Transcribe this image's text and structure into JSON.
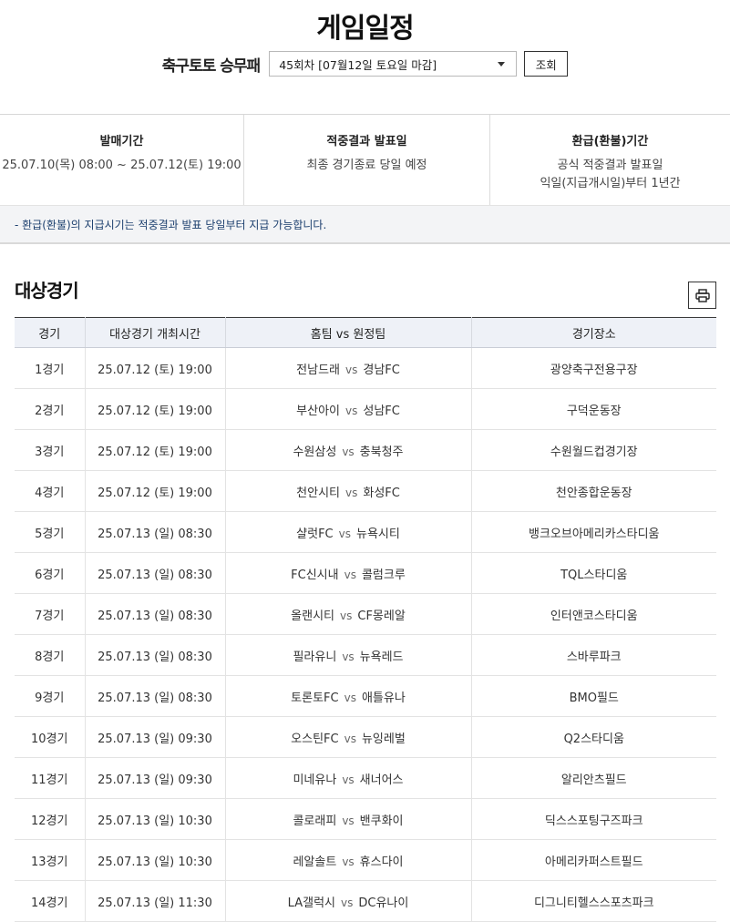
{
  "page": {
    "title": "게임일정"
  },
  "selector": {
    "game_name": "축구토토 승무패",
    "round_value": "45회차 [07월12일 토요일 마감]",
    "query_label": "조회"
  },
  "info": {
    "sale_period": {
      "label": "발매기간",
      "value": "25.07.10(목) 08:00 ~ 25.07.12(토) 19:00"
    },
    "result_date": {
      "label": "적중결과 발표일",
      "value": "최종 경기종료 당일 예정"
    },
    "refund_period": {
      "label": "환급(환불)기간",
      "line1": "공식 적중결과 발표일",
      "line2": "익일(지급개시일)부터 1년간"
    }
  },
  "notice": "- 환급(환불)의 지급시기는 적중결과 발표 당일부터 지급 가능합니다.",
  "section": {
    "title": "대상경기",
    "print_icon": "printer-icon"
  },
  "table": {
    "headers": [
      "경기",
      "대상경기 개최시간",
      "홈팀 vs 원정팀",
      "경기장소"
    ],
    "vs_label": "vs",
    "rows": [
      {
        "no": "1경기",
        "time": "25.07.12 (토) 19:00",
        "home": "전남드래",
        "away": "경남FC",
        "venue": "광양축구전용구장"
      },
      {
        "no": "2경기",
        "time": "25.07.12 (토) 19:00",
        "home": "부산아이",
        "away": "성남FC",
        "venue": "구덕운동장"
      },
      {
        "no": "3경기",
        "time": "25.07.12 (토) 19:00",
        "home": "수원삼성",
        "away": "충북청주",
        "venue": "수원월드컵경기장"
      },
      {
        "no": "4경기",
        "time": "25.07.12 (토) 19:00",
        "home": "천안시티",
        "away": "화성FC",
        "venue": "천안종합운동장"
      },
      {
        "no": "5경기",
        "time": "25.07.13 (일) 08:30",
        "home": "샬럿FC",
        "away": "뉴욕시티",
        "venue": "뱅크오브아메리카스타디움"
      },
      {
        "no": "6경기",
        "time": "25.07.13 (일) 08:30",
        "home": "FC신시내",
        "away": "콜럼크루",
        "venue": "TQL스타디움"
      },
      {
        "no": "7경기",
        "time": "25.07.13 (일) 08:30",
        "home": "올랜시티",
        "away": "CF몽레알",
        "venue": "인터앤코스타디움"
      },
      {
        "no": "8경기",
        "time": "25.07.13 (일) 08:30",
        "home": "필라유니",
        "away": "뉴욕레드",
        "venue": "스바루파크"
      },
      {
        "no": "9경기",
        "time": "25.07.13 (일) 08:30",
        "home": "토론토FC",
        "away": "애틀유나",
        "venue": "BMO필드"
      },
      {
        "no": "10경기",
        "time": "25.07.13 (일) 09:30",
        "home": "오스틴FC",
        "away": "뉴잉레벌",
        "venue": "Q2스타디움"
      },
      {
        "no": "11경기",
        "time": "25.07.13 (일) 09:30",
        "home": "미네유나",
        "away": "새너어스",
        "venue": "알리안츠필드"
      },
      {
        "no": "12경기",
        "time": "25.07.13 (일) 10:30",
        "home": "콜로래피",
        "away": "밴쿠화이",
        "venue": "딕스스포팅구즈파크"
      },
      {
        "no": "13경기",
        "time": "25.07.13 (일) 10:30",
        "home": "레알솔트",
        "away": "휴스다이",
        "venue": "아메리카퍼스트필드"
      },
      {
        "no": "14경기",
        "time": "25.07.13 (일) 11:30",
        "home": "LA갤럭시",
        "away": "DC유나이",
        "venue": "디그니티헬스스포츠파크"
      }
    ]
  }
}
